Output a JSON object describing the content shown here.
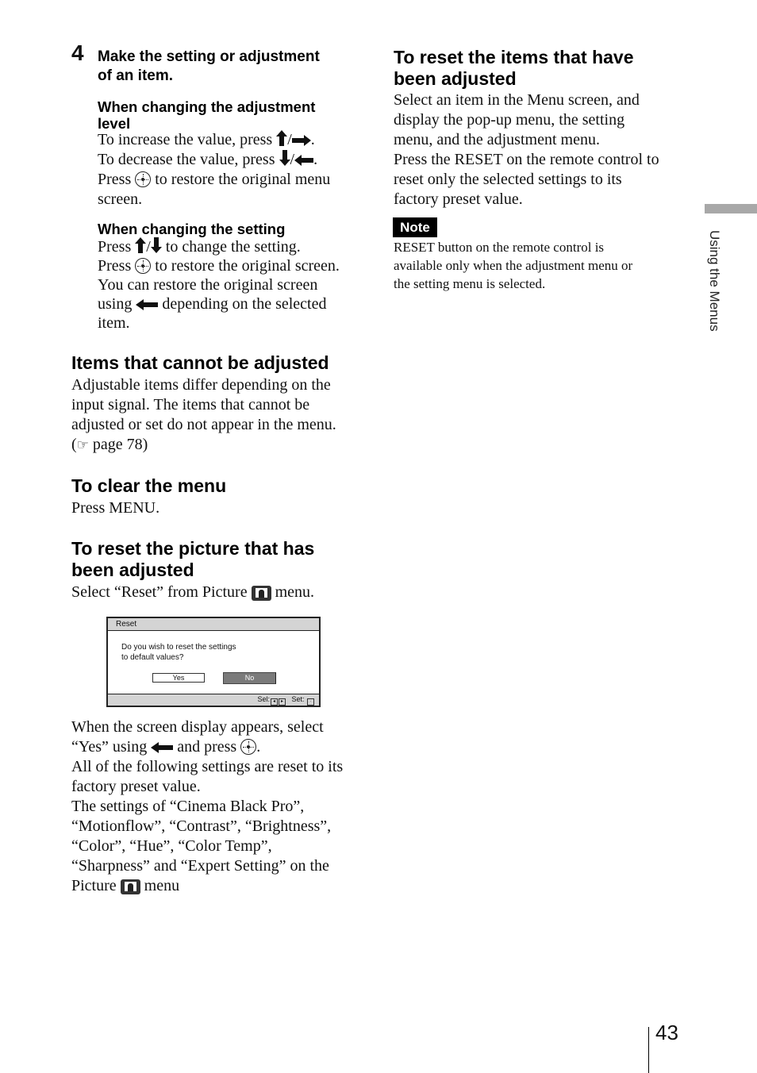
{
  "left_column": {
    "step": {
      "number": "4",
      "title_lines": [
        "Make the setting or adjustment",
        "of an item."
      ]
    },
    "adjustment_level": {
      "heading_lines": [
        "When changing the adjustment",
        "level"
      ],
      "increase_text": "To increase the value, press",
      "decrease_text": "To decrease the value, press",
      "press_text": "Press",
      "restore_menu_text": "to restore the original menu",
      "restore_menu_cont": "screen.",
      "slash": "/",
      "period": "."
    },
    "setting": {
      "heading": "When changing the setting",
      "press_text": "Press",
      "change_text": "to change the setting.",
      "restore_text": "to restore the original screen.",
      "line3": "You can restore the original screen",
      "using_text": "using",
      "depending_text": "depending on the selected",
      "line5": "item.",
      "slash": "/"
    },
    "cannot_adjust": {
      "heading": "Items that cannot be adjusted",
      "lines": [
        "Adjustable items differ depending on the",
        "input signal. The items that cannot be",
        "adjusted or set do not appear in the menu."
      ],
      "ref_open": "(",
      "ref_icon": "☞",
      "ref_text": " page 78)"
    },
    "clear_menu": {
      "heading": "To clear the menu",
      "text": "Press MENU."
    },
    "reset_picture": {
      "heading_lines": [
        "To reset the picture that has",
        "been adjusted"
      ],
      "select_before": "Select “Reset” from Picture",
      "select_after": "menu.",
      "dialog": {
        "title": "Reset",
        "message_lines": [
          "Do you wish to reset the settings",
          "to default values?"
        ],
        "yes_label": "Yes",
        "no_label": "No",
        "sel_label": "Sel:",
        "set_label": "Set:"
      },
      "after_lines": {
        "l1": "When the screen display appears, select",
        "l2_a": "“Yes” using",
        "l2_b": "and press",
        "l2_c": ".",
        "l3": "All of the following settings are reset to its",
        "l4": "factory preset value.",
        "l5": "The settings of “Cinema Black Pro”,",
        "l6": "“Motionflow”, “Contrast”, “Brightness”,",
        "l7": "“Color”, “Hue”, “Color Temp”,",
        "l8": "“Sharpness” and “Expert Setting” on the",
        "l9_a": "Picture",
        "l9_b": "menu"
      }
    }
  },
  "right_column": {
    "reset_items": {
      "heading_lines": [
        "To reset the items that have",
        "been adjusted"
      ],
      "lines": [
        "Select an item in the Menu screen, and",
        "display the pop-up menu, the setting",
        "menu, and the adjustment menu.",
        "Press the RESET on the remote control to",
        "reset only the selected settings to its",
        "factory preset value."
      ]
    },
    "note": {
      "label": "Note",
      "lines": [
        "RESET button on the remote control is",
        "available only when the adjustment menu or",
        "the setting menu is selected."
      ]
    }
  },
  "side_tab": {
    "label": "Using the Menus",
    "color": "#a8a8a8"
  },
  "page_number": "43"
}
